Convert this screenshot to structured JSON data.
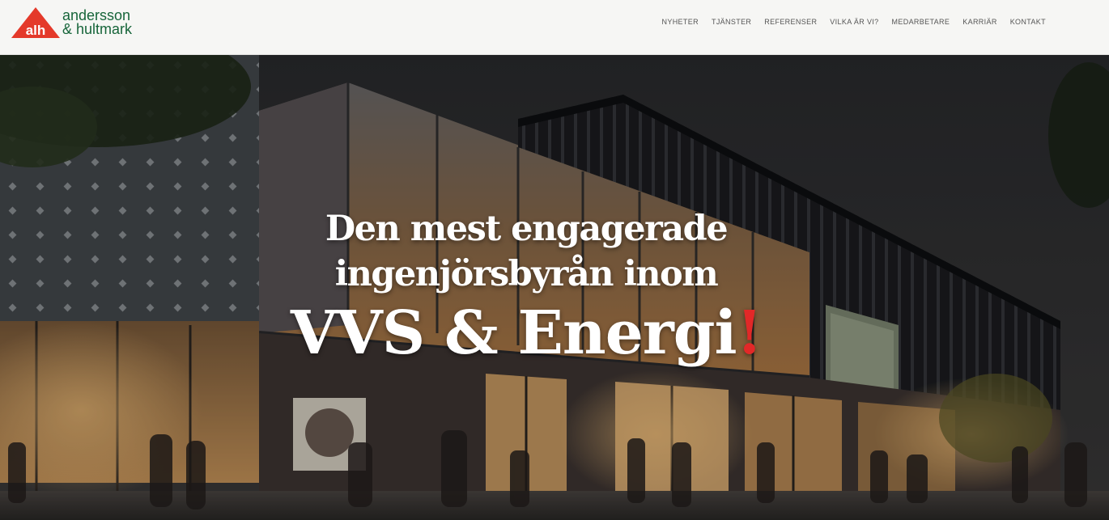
{
  "brand": {
    "line1": "andersson",
    "line2": "& hultmark",
    "mark_text": "alh",
    "accent_color": "#e4392a",
    "text_color": "#17653a"
  },
  "nav": {
    "items": [
      {
        "label": "NYHETER"
      },
      {
        "label": "TJÄNSTER"
      },
      {
        "label": "REFERENSER"
      },
      {
        "label": "VILKA ÄR VI?"
      },
      {
        "label": "MEDARBETARE"
      },
      {
        "label": "KARRIÄR"
      },
      {
        "label": "KONTAKT"
      }
    ]
  },
  "hero": {
    "line1": "Den mest engagerade",
    "line2": "ingenjörsbyrån inom",
    "line3": "VVS & Energi",
    "line3_accent": "!",
    "accent_color": "#e22828",
    "background_icon": "building-photo"
  }
}
